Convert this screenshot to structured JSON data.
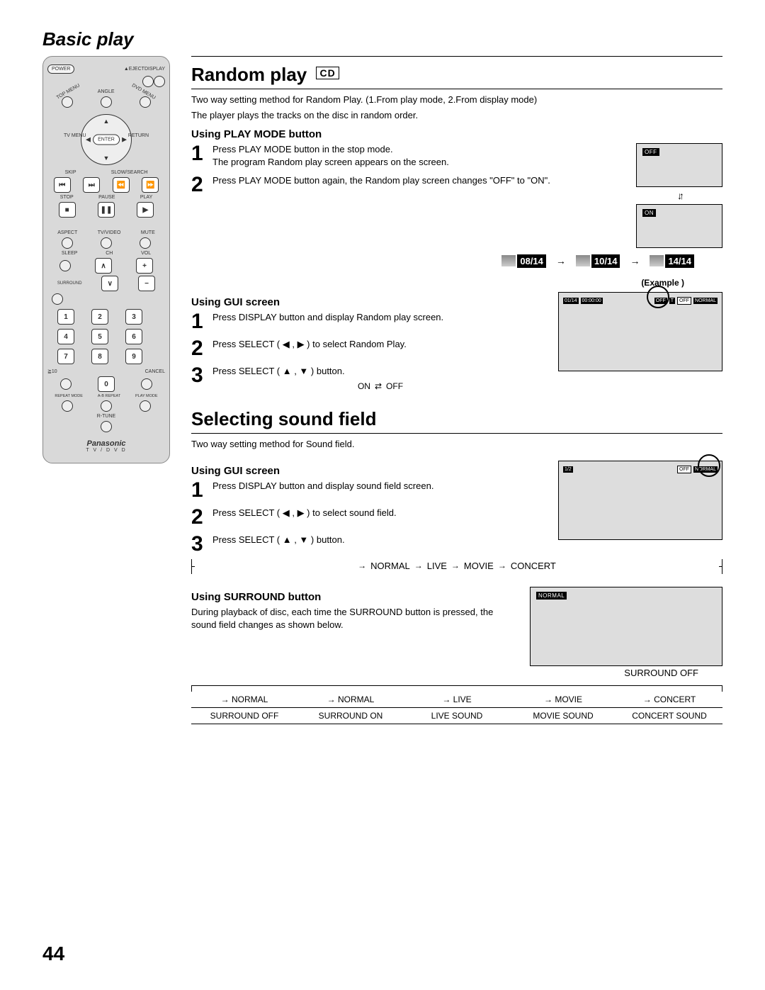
{
  "pageTitle": "Basic play",
  "pageNumber": "44",
  "remote": {
    "power": "POWER",
    "eject": "▲EJECT",
    "display": "DISPLAY",
    "topMenu": "TOP MENU",
    "angle": "ANGLE",
    "dvdMenu": "DVD MENU",
    "tvMenu": "TV MENU",
    "enter": "ENTER",
    "return": "RETURN",
    "skip": "SKIP",
    "slow": "SLOW/SEARCH",
    "stop": "STOP",
    "pause": "PAUSE",
    "play": "PLAY",
    "aspect": "ASPECT",
    "tvvideo": "TV/VIDEO",
    "mute": "MUTE",
    "sleep": "SLEEP",
    "ch": "CH",
    "vol": "VOL",
    "surround": "SURROUND",
    "keys": [
      "1",
      "2",
      "3",
      "4",
      "5",
      "6",
      "7",
      "8",
      "9"
    ],
    "zero": "0",
    "gt10": "≧10",
    "cancel": "CANCEL",
    "repeat": "REPEAT MODE",
    "ab": "A-B REPEAT",
    "playmode": "PLAY MODE",
    "rtune": "R-TUNE",
    "brand": "Panasonic",
    "brandSub": "T V / D V D"
  },
  "random": {
    "title": "Random play",
    "tag": "CD",
    "intro1": "Two way setting method for Random Play. (1.From play mode, 2.From display mode)",
    "intro2": "The player plays the tracks on the disc in random order.",
    "playMode": {
      "heading": "Using PLAY MODE button",
      "s1a": "Press PLAY MODE button in the stop mode.",
      "s1b": "The program Random play screen appears on the screen.",
      "s2": "Press PLAY MODE button again, the Random play screen changes \"OFF\" to \"ON\".",
      "chipOff": "OFF",
      "chipOn": "ON",
      "tracks": [
        "08/14",
        "10/14",
        "14/14"
      ]
    },
    "gui": {
      "heading": "Using GUI screen",
      "example": "(Example )",
      "s1": "Press DISPLAY button and display Random play screen.",
      "s2": "Press SELECT ( ◀ , ▶ ) to select Random Play.",
      "s3": "Press SELECT ( ▲ , ▼ ) button.",
      "on": "ON",
      "off": "OFF",
      "chips": {
        "track": "01/14",
        "time": "00:00:00",
        "off": "OFF",
        "t": "T",
        "offR": "OFF",
        "normal": "NORMAL"
      }
    }
  },
  "sound": {
    "title": "Selecting sound field",
    "intro": "Two way setting method for Sound field.",
    "gui": {
      "heading": "Using GUI screen",
      "s1": "Press DISPLAY button and display sound field screen.",
      "s2": "Press SELECT ( ◀ , ▶ ) to select sound field.",
      "s3": "Press SELECT ( ▲ , ▼ ) button.",
      "flow": [
        "NORMAL",
        "LIVE",
        "MOVIE",
        "CONCERT"
      ],
      "chips": {
        "track": "1/2",
        "off": "OFF",
        "normal": "NORMAL"
      }
    },
    "surround": {
      "heading": "Using SURROUND button",
      "body": "During playback of disc, each time the SURROUND button is pressed, the sound field changes as shown below.",
      "caption": "SURROUND OFF",
      "chip": "NORMAL"
    },
    "table": {
      "r1": [
        "NORMAL",
        "NORMAL",
        "LIVE",
        "MOVIE",
        "CONCERT"
      ],
      "r2": [
        "SURROUND OFF",
        "SURROUND ON",
        "LIVE SOUND",
        "MOVIE SOUND",
        "CONCERT SOUND"
      ]
    }
  }
}
